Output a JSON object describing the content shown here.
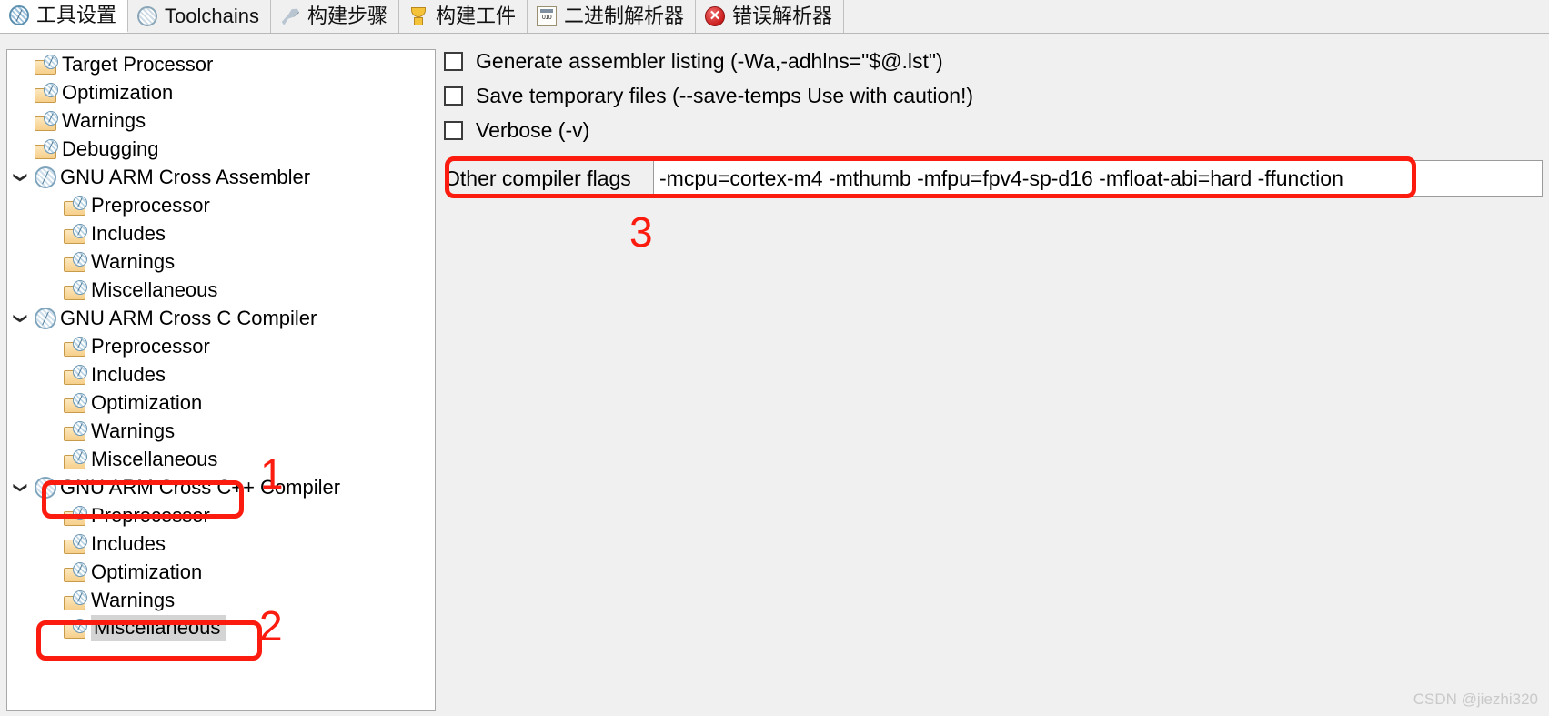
{
  "tabs": [
    {
      "label": "工具设置",
      "icon": "globe-icon",
      "active": true
    },
    {
      "label": "Toolchains",
      "icon": "globe-gray-icon",
      "active": false
    },
    {
      "label": "构建步骤",
      "icon": "hammer-icon",
      "active": false
    },
    {
      "label": "构建工件",
      "icon": "trophy-icon",
      "active": false
    },
    {
      "label": "二进制解析器",
      "icon": "binary-file-icon",
      "active": false
    },
    {
      "label": "错误解析器",
      "icon": "error-icon",
      "active": false
    }
  ],
  "tree": {
    "items": [
      {
        "label": "Target Processor",
        "level": 1,
        "icon": "folder-globe-icon",
        "twisty": "",
        "selected": false
      },
      {
        "label": "Optimization",
        "level": 1,
        "icon": "folder-globe-icon",
        "twisty": "",
        "selected": false
      },
      {
        "label": "Warnings",
        "level": 1,
        "icon": "folder-globe-icon",
        "twisty": "",
        "selected": false
      },
      {
        "label": "Debugging",
        "level": 1,
        "icon": "folder-globe-icon",
        "twisty": "",
        "selected": false
      },
      {
        "label": "GNU ARM Cross Assembler",
        "level": 0,
        "icon": "node-globe-icon",
        "twisty": "expanded",
        "selected": false
      },
      {
        "label": "Preprocessor",
        "level": 2,
        "icon": "folder-globe-icon",
        "twisty": "",
        "selected": false
      },
      {
        "label": "Includes",
        "level": 2,
        "icon": "folder-globe-icon",
        "twisty": "",
        "selected": false
      },
      {
        "label": "Warnings",
        "level": 2,
        "icon": "folder-globe-icon",
        "twisty": "",
        "selected": false
      },
      {
        "label": "Miscellaneous",
        "level": 2,
        "icon": "folder-globe-icon",
        "twisty": "",
        "selected": false
      },
      {
        "label": "GNU ARM Cross C Compiler",
        "level": 0,
        "icon": "node-globe-icon",
        "twisty": "expanded",
        "selected": false
      },
      {
        "label": "Preprocessor",
        "level": 2,
        "icon": "folder-globe-icon",
        "twisty": "",
        "selected": false
      },
      {
        "label": "Includes",
        "level": 2,
        "icon": "folder-globe-icon",
        "twisty": "",
        "selected": false
      },
      {
        "label": "Optimization",
        "level": 2,
        "icon": "folder-globe-icon",
        "twisty": "",
        "selected": false
      },
      {
        "label": "Warnings",
        "level": 2,
        "icon": "folder-globe-icon",
        "twisty": "",
        "selected": false
      },
      {
        "label": "Miscellaneous",
        "level": 2,
        "icon": "folder-globe-icon",
        "twisty": "",
        "selected": false
      },
      {
        "label": "GNU ARM Cross C++ Compiler",
        "level": 0,
        "icon": "node-globe-icon",
        "twisty": "expanded",
        "selected": false
      },
      {
        "label": "Preprocessor",
        "level": 2,
        "icon": "folder-globe-icon",
        "twisty": "",
        "selected": false
      },
      {
        "label": "Includes",
        "level": 2,
        "icon": "folder-globe-icon",
        "twisty": "",
        "selected": false
      },
      {
        "label": "Optimization",
        "level": 2,
        "icon": "folder-globe-icon",
        "twisty": "",
        "selected": false
      },
      {
        "label": "Warnings",
        "level": 2,
        "icon": "folder-globe-icon",
        "twisty": "",
        "selected": false
      },
      {
        "label": "Miscellaneous",
        "level": 2,
        "icon": "folder-globe-icon",
        "twisty": "",
        "selected": true
      }
    ]
  },
  "options": {
    "checkboxes": [
      {
        "label": "Generate assembler listing (-Wa,-adhlns=\"$@.lst\")",
        "checked": false
      },
      {
        "label": "Save temporary files (--save-temps Use with caution!)",
        "checked": false
      },
      {
        "label": "Verbose (-v)",
        "checked": false
      }
    ],
    "other_flags": {
      "label": "Other compiler flags",
      "value": "-mcpu=cortex-m4 -mthumb -mfpu=fpv4-sp-d16 -mfloat-abi=hard -ffunction",
      "placeholder": ""
    }
  },
  "annotations": {
    "markers": [
      {
        "number": "1",
        "target": "tree-miscellaneous-c-compiler"
      },
      {
        "number": "2",
        "target": "tree-miscellaneous-cpp-compiler"
      },
      {
        "number": "3",
        "target": "other-compiler-flags-row"
      }
    ],
    "color": "#fc1b0f"
  },
  "watermark": "CSDN @jiezhi320"
}
